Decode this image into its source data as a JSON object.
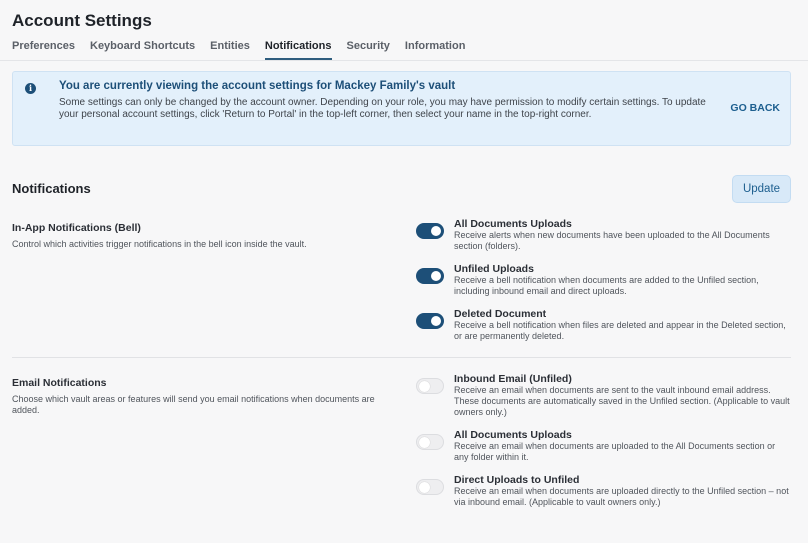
{
  "page_title": "Account Settings",
  "tabs": [
    {
      "label": "Preferences"
    },
    {
      "label": "Keyboard Shortcuts"
    },
    {
      "label": "Entities"
    },
    {
      "label": "Notifications"
    },
    {
      "label": "Security"
    },
    {
      "label": "Information"
    }
  ],
  "active_tab": "Notifications",
  "banner": {
    "icon": "info-icon",
    "title": "You are currently viewing the account settings for Mackey Family's vault",
    "body": "Some settings can only be changed by the account owner. Depending on your role, you may have permission to modify certain settings. To update your personal account settings, click 'Return to Portal' in the top-left corner, then select your name in the top-right corner.",
    "action": "GO BACK"
  },
  "section": {
    "title": "Notifications",
    "update_label": "Update"
  },
  "in_app": {
    "title": "In-App Notifications (Bell)",
    "description": "Control which activities trigger notifications in the bell icon inside the vault.",
    "options": [
      {
        "label": "All Documents Uploads",
        "description": "Receive alerts when new documents have been uploaded to the All Documents section (folders).",
        "enabled": true
      },
      {
        "label": "Unfiled Uploads",
        "description": "Receive a bell notification when documents are added to the Unfiled section, including inbound email and direct uploads.",
        "enabled": true
      },
      {
        "label": "Deleted Document",
        "description": "Receive a bell notification when files are deleted and appear in the Deleted section, or are permanently deleted.",
        "enabled": true
      }
    ]
  },
  "email": {
    "title": "Email Notifications",
    "description": "Choose which vault areas or features will send you email notifications when documents are added.",
    "options": [
      {
        "label": "Inbound Email (Unfiled)",
        "description": "Receive an email when documents are sent to the vault inbound email address. These documents are automatically saved in the Unfiled section. (Applicable to vault owners only.)",
        "enabled": false
      },
      {
        "label": "All Documents Uploads",
        "description": "Receive an email when documents are uploaded to the All Documents section or any folder within it.",
        "enabled": false
      },
      {
        "label": "Direct Uploads to Unfiled",
        "description": "Receive an email when documents are uploaded directly to the Unfiled section – not via inbound email. (Applicable to vault owners only.)",
        "enabled": false
      }
    ]
  },
  "colors": {
    "accent": "#1d4f78",
    "banner_bg": "#e3f0fb",
    "page_bg": "#f7f7f8"
  }
}
